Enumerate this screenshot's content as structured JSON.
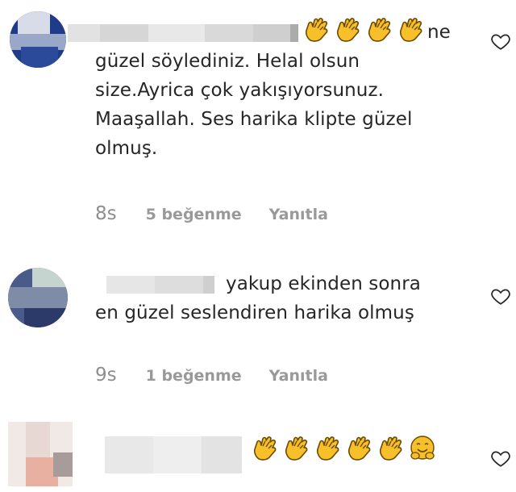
{
  "comments": [
    {
      "text_after_emojis": "ne",
      "text": "güzel söylediniz. Helal olsun\nsize.Ayrica çok yakışıyorsunuz.\nMaaşallah. Ses harika klipte güzel\nolmuş.",
      "time": "8s",
      "likes": "5 beğenme",
      "reply": "Yanıtla",
      "emojis": [
        "clap-icon",
        "clap-icon",
        "clap-icon",
        "clap-icon"
      ]
    },
    {
      "text": "yakup ekinden sonra\nen güzel seslendiren harika olmuş",
      "time": "9s",
      "likes": "1 beğenme",
      "reply": "Yanıtla"
    },
    {
      "emojis": [
        "clap-icon",
        "clap-icon",
        "clap-icon",
        "clap-icon",
        "clap-icon",
        "hugging-face-icon"
      ]
    }
  ],
  "colors": {
    "text": "#262626",
    "meta": "#8e8e8e",
    "emoji": "#f7c02b"
  }
}
